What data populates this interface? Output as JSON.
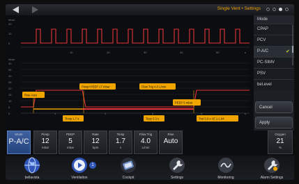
{
  "header": {
    "title": "Single Vent • Settings",
    "nav_back_icon": "chevron-left-icon",
    "nav_forward_icon": "chevron-right-icon",
    "page_dots": 4,
    "active_page_dot": 3
  },
  "graph": {
    "top_unit": "mbar",
    "top_y_ticks": [
      "20",
      "10",
      "0"
    ],
    "top_x_ticks": [
      "10",
      "20",
      "30",
      "40",
      "50",
      "s"
    ],
    "bottom_unit": "mbar",
    "bottom_y_ticks": [
      "40",
      "35",
      "30",
      "25",
      "20",
      "15",
      "10",
      "5",
      "0"
    ],
    "bottom_x_ticks": [
      "1",
      "2",
      "3",
      "4",
      "s"
    ],
    "callouts": {
      "rise": "Rise Auto",
      "pinsp": "Pinsp+PEEP 17 mbar",
      "flow_trig": "Flow Trig 4.0 L/min",
      "peep": "PEEP 5 mbar",
      "tinsp": "Tinsp 1.7 s",
      "texp": "Texp 3.3 s",
      "ttot": "Ttot 5.0 s  I:E 1:1.94"
    }
  },
  "mode_menu": {
    "header": "Mode",
    "items": [
      {
        "label": "CPAP",
        "selected": false
      },
      {
        "label": "PCV",
        "selected": false
      },
      {
        "label": "P-A/C",
        "selected": true
      },
      {
        "label": "PC-SIMV",
        "selected": false
      },
      {
        "label": "PSV",
        "selected": false
      },
      {
        "label": "bel.evel",
        "selected": false
      }
    ],
    "cancel": "Cancel",
    "apply": "Apply"
  },
  "params": [
    {
      "label": "Mode",
      "value": "P-A/C",
      "unit": ""
    },
    {
      "label": "Pinsp",
      "value": "12",
      "unit": "mbar"
    },
    {
      "label": "PEEP",
      "value": "5",
      "unit": "mbar"
    },
    {
      "label": "Rate",
      "value": "12",
      "unit": "bpm"
    },
    {
      "label": "Tinsp",
      "value": "1.7",
      "unit": "s"
    },
    {
      "label": "Flow Trig",
      "value": "4.0",
      "unit": "L/min"
    },
    {
      "label": "Rise",
      "value": "Auto",
      "unit": ""
    },
    {
      "label": "Oxygen",
      "value": "21",
      "unit": "%"
    }
  ],
  "dock": [
    {
      "label": "bellavista",
      "icon": "globe-icon"
    },
    {
      "label": "Ventilation",
      "icon": "play-icon",
      "badge": "1"
    },
    {
      "label": "Cockpit",
      "icon": "lungs-icon"
    },
    {
      "label": "Settings",
      "icon": "wrench-icon"
    },
    {
      "label": "Monitoring",
      "icon": "chart-icon"
    },
    {
      "label": "Alarm Settings",
      "icon": "alarm-wrench-icon"
    }
  ],
  "colors": {
    "accent": "#f0a400",
    "waveform": "#e8343a",
    "select": "#c8d83a",
    "mode_blue": "#2f5aa6"
  }
}
